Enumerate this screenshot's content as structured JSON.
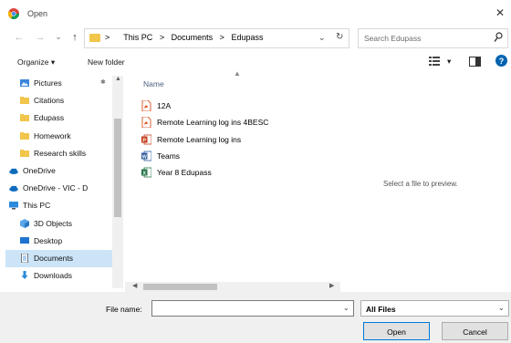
{
  "window": {
    "title": "Open",
    "close_glyph": "✕"
  },
  "navigation": {
    "back_glyph": "←",
    "forward_glyph": "→",
    "recent_glyph": "⌄",
    "up_glyph": "↑"
  },
  "address": {
    "root_glyph": ">",
    "crumbs": [
      "This PC",
      "Documents",
      "Edupass"
    ],
    "sep": ">",
    "dropdown_glyph": "⌄",
    "refresh_glyph": "↻"
  },
  "search": {
    "placeholder": "Search Edupass"
  },
  "toolbar": {
    "organize": "Organize ▾",
    "new_folder": "New folder",
    "view_glyph": "▾"
  },
  "nav_pane": {
    "items": [
      {
        "label": "Pictures",
        "icon": "pictures-icon",
        "pin": "✱",
        "indent": 1
      },
      {
        "label": "Citations",
        "icon": "folder-icon",
        "indent": 1
      },
      {
        "label": "Edupass",
        "icon": "folder-icon",
        "indent": 1
      },
      {
        "label": "Homework",
        "icon": "folder-icon",
        "indent": 1
      },
      {
        "label": "Research skills",
        "icon": "folder-icon",
        "indent": 1
      },
      {
        "label": "OneDrive",
        "icon": "cloud-icon",
        "indent": 0
      },
      {
        "label": "OneDrive - VIC - D",
        "icon": "cloud-icon",
        "indent": 0
      },
      {
        "label": "This PC",
        "icon": "pc-icon",
        "indent": 0
      },
      {
        "label": "3D Objects",
        "icon": "cube-icon",
        "indent": 1
      },
      {
        "label": "Desktop",
        "icon": "desktop-icon",
        "indent": 1
      },
      {
        "label": "Documents",
        "icon": "documents-icon",
        "indent": 1,
        "selected": true
      },
      {
        "label": "Downloads",
        "icon": "download-icon",
        "indent": 1
      }
    ]
  },
  "file_list": {
    "column": "Name",
    "files": [
      {
        "name": "12A",
        "type": "pdf"
      },
      {
        "name": "Remote Learning log ins 4BESC",
        "type": "pdf"
      },
      {
        "name": "Remote Learning log ins",
        "type": "ppt"
      },
      {
        "name": "Teams",
        "type": "word"
      },
      {
        "name": "Year 8 Edupass",
        "type": "excel"
      }
    ]
  },
  "preview": {
    "text": "Select a file to preview."
  },
  "bottom": {
    "file_name_label": "File name:",
    "file_name_value": "",
    "file_type": "All Files",
    "dropdown_glyph": "⌄",
    "open_label": "Open",
    "cancel_label": "Cancel"
  },
  "scrollbar_glyphs": {
    "up": "▲",
    "left": "◀",
    "right": "▶"
  },
  "colors": {
    "folder": "#f2c54b",
    "selection": "#cce4f7",
    "accent": "#0078d7",
    "pdf": "#d83b01",
    "ppt": "#c43e1c",
    "word": "#2b579a",
    "excel": "#217346"
  }
}
